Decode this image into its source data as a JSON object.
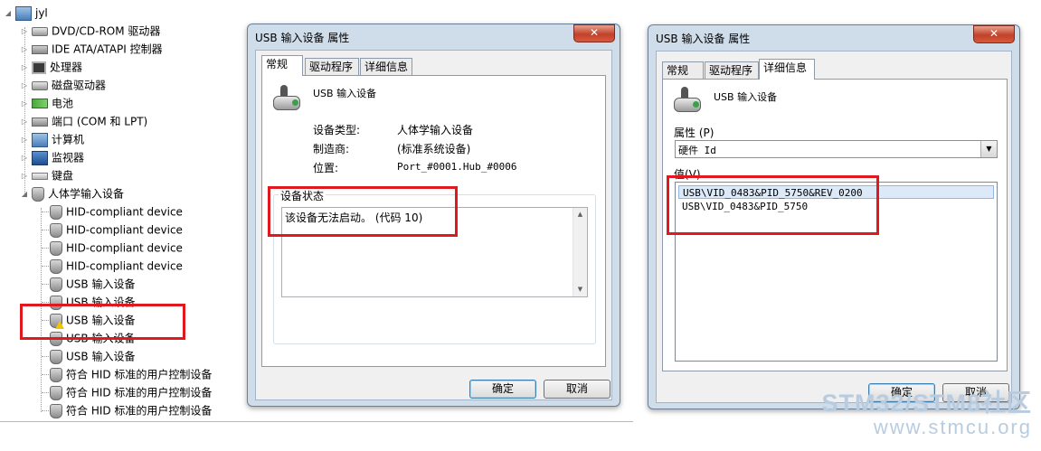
{
  "tree": {
    "root": "jyl",
    "items": [
      {
        "label": "DVD/CD-ROM 驱动器",
        "icon": "optical-drive-icon"
      },
      {
        "label": "IDE ATA/ATAPI 控制器",
        "icon": "ide-controller-icon"
      },
      {
        "label": "处理器",
        "icon": "processor-icon"
      },
      {
        "label": "磁盘驱动器",
        "icon": "disk-drive-icon"
      },
      {
        "label": "电池",
        "icon": "battery-icon"
      },
      {
        "label": "端口 (COM 和 LPT)",
        "icon": "port-icon"
      },
      {
        "label": "计算机",
        "icon": "computer-icon"
      },
      {
        "label": "监视器",
        "icon": "monitor-icon"
      },
      {
        "label": "键盘",
        "icon": "keyboard-icon"
      },
      {
        "label": "人体学输入设备",
        "icon": "hid-icon"
      }
    ],
    "hid_children": [
      "HID-compliant device",
      "HID-compliant device",
      "HID-compliant device",
      "HID-compliant device",
      "USB 输入设备",
      "USB 输入设备",
      "USB 输入设备",
      "USB 输入设备",
      "USB 输入设备",
      "符合 HID 标准的用户控制设备",
      "符合 HID 标准的用户控制设备",
      "符合 HID 标准的用户控制设备"
    ]
  },
  "dialog1": {
    "title": "USB 输入设备 属性",
    "close": "✕",
    "tabs": [
      "常规",
      "驱动程序",
      "详细信息"
    ],
    "device_name": "USB 输入设备",
    "device_type_label": "设备类型:",
    "device_type": "人体学输入设备",
    "manufacturer_label": "制造商:",
    "manufacturer": "(标准系统设备)",
    "location_label": "位置:",
    "location": "Port_#0001.Hub_#0006",
    "status_group": "设备状态",
    "status_text": "该设备无法启动。 (代码 10)",
    "ok": "确定",
    "cancel": "取消"
  },
  "dialog2": {
    "title": "USB 输入设备 属性",
    "close": "✕",
    "tabs": [
      "常规",
      "驱动程序",
      "详细信息"
    ],
    "device_name": "USB 输入设备",
    "property_label": "属性 (P)",
    "property_value": "硬件 Id",
    "value_label": "值(V)",
    "values": [
      "USB\\VID_0483&PID_5750&REV_0200",
      "USB\\VID_0483&PID_5750"
    ],
    "ok": "确定",
    "cancel": "取消"
  },
  "watermark": {
    "line1": "STM32/STM8社区",
    "line2": "www.stmcu.org"
  }
}
